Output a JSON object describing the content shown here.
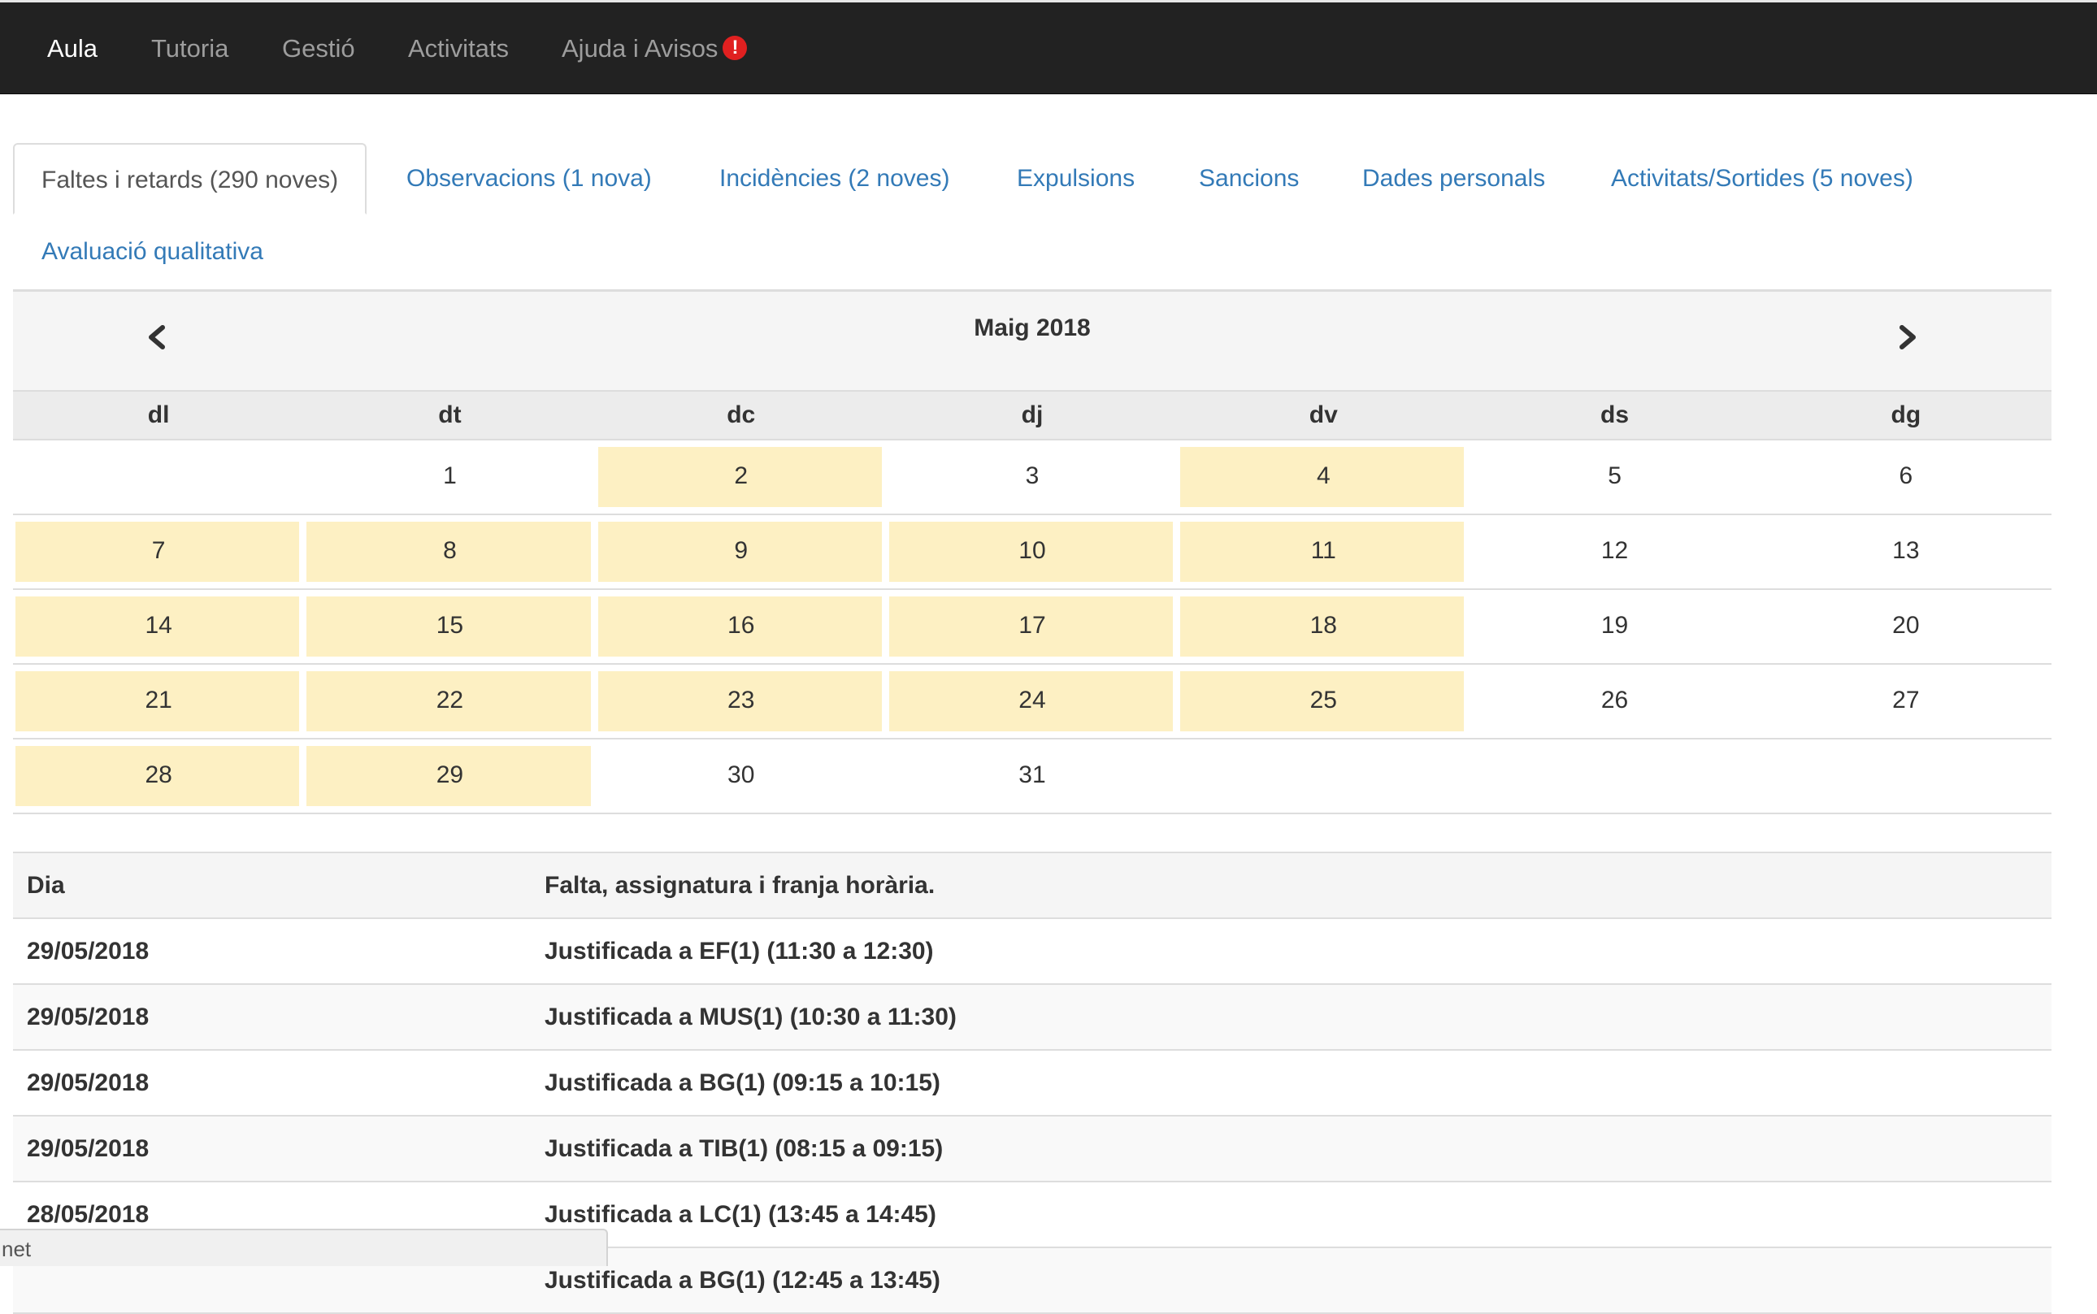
{
  "navbar": {
    "items": [
      {
        "label": "Aula",
        "active": true
      },
      {
        "label": "Tutoria"
      },
      {
        "label": "Gestió"
      },
      {
        "label": "Activitats"
      },
      {
        "label": "Ajuda i Avisos"
      }
    ],
    "alert_icon": "exclamation-circle-icon",
    "alert_glyph": "!",
    "alert_color": "#e02020"
  },
  "tabs": [
    {
      "label": "Faltes i retards (290 noves)",
      "active": true
    },
    {
      "label": "Observacions (1 nova)"
    },
    {
      "label": "Incidències (2 noves)"
    },
    {
      "label": "Expulsions"
    },
    {
      "label": "Sancions"
    },
    {
      "label": "Dades personals"
    },
    {
      "label": "Activitats/Sortides (5 noves)"
    },
    {
      "label": "Avaluació qualitativa"
    }
  ],
  "calendar": {
    "title": "Maig 2018",
    "prev_icon": "chevron-left-icon",
    "next_icon": "chevron-right-icon",
    "day_names": [
      "dl",
      "dt",
      "dc",
      "dj",
      "dv",
      "ds",
      "dg"
    ],
    "highlight_color": "#fdf0c3",
    "weeks": [
      [
        {
          "day": ""
        },
        {
          "day": "1"
        },
        {
          "day": "2",
          "marked": true
        },
        {
          "day": "3"
        },
        {
          "day": "4",
          "marked": true
        },
        {
          "day": "5"
        },
        {
          "day": "6"
        }
      ],
      [
        {
          "day": "7",
          "marked": true
        },
        {
          "day": "8",
          "marked": true
        },
        {
          "day": "9",
          "marked": true
        },
        {
          "day": "10",
          "marked": true
        },
        {
          "day": "11",
          "marked": true
        },
        {
          "day": "12"
        },
        {
          "day": "13"
        }
      ],
      [
        {
          "day": "14",
          "marked": true
        },
        {
          "day": "15",
          "marked": true
        },
        {
          "day": "16",
          "marked": true
        },
        {
          "day": "17",
          "marked": true
        },
        {
          "day": "18",
          "marked": true
        },
        {
          "day": "19"
        },
        {
          "day": "20"
        }
      ],
      [
        {
          "day": "21",
          "marked": true
        },
        {
          "day": "22",
          "marked": true
        },
        {
          "day": "23",
          "marked": true
        },
        {
          "day": "24",
          "marked": true
        },
        {
          "day": "25",
          "marked": true
        },
        {
          "day": "26"
        },
        {
          "day": "27"
        }
      ],
      [
        {
          "day": "28",
          "marked": true
        },
        {
          "day": "29",
          "marked": true
        },
        {
          "day": "30"
        },
        {
          "day": "31"
        },
        {
          "day": ""
        },
        {
          "day": ""
        },
        {
          "day": ""
        }
      ]
    ]
  },
  "absences": {
    "header": {
      "day": "Dia",
      "desc": "Falta, assignatura i franja horària."
    },
    "rows": [
      {
        "day": "29/05/2018",
        "desc": "Justificada a EF(1) (11:30 a 12:30)"
      },
      {
        "day": "29/05/2018",
        "desc": "Justificada a MUS(1) (10:30 a 11:30)"
      },
      {
        "day": "29/05/2018",
        "desc": "Justificada a BG(1) (09:15 a 10:15)"
      },
      {
        "day": "29/05/2018",
        "desc": "Justificada a TIB(1) (08:15 a 09:15)"
      },
      {
        "day": "28/05/2018",
        "desc": "Justificada a LC(1) (13:45 a 14:45)"
      },
      {
        "day": "",
        "desc": "Justificada a BG(1) (12:45 a 13:45)"
      }
    ]
  },
  "status_bar": {
    "text": "net"
  }
}
